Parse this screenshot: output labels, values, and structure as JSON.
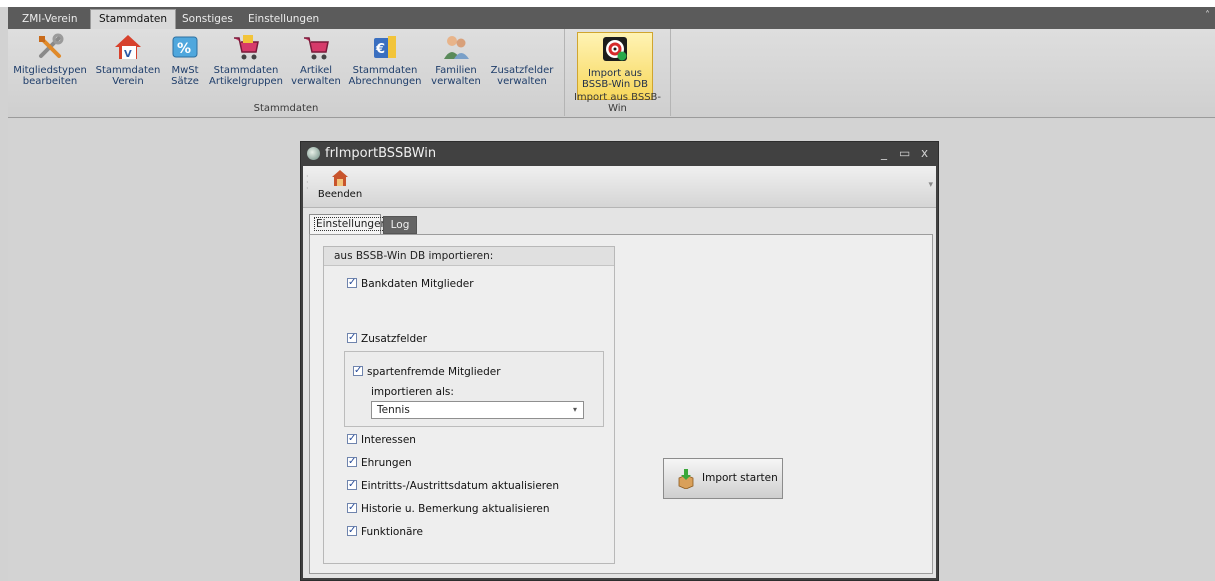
{
  "ribbon": {
    "tabs": [
      "ZMI-Verein",
      "Stammdaten",
      "Sonstiges",
      "Einstellungen"
    ],
    "active_tab": "Stammdaten",
    "groups": {
      "stammdaten": {
        "label": "Stammdaten",
        "buttons": [
          {
            "label1": "Mitgliedstypen",
            "label2": "bearbeiten",
            "icon": "tools-icon"
          },
          {
            "label1": "Stammdaten",
            "label2": "Verein",
            "icon": "house-icon"
          },
          {
            "label1": "MwSt",
            "label2": "Sätze",
            "icon": "percent-icon"
          },
          {
            "label1": "Stammdaten",
            "label2": "Artikelgruppen",
            "icon": "cart-icon"
          },
          {
            "label1": "Artikel",
            "label2": "verwalten",
            "icon": "cart-icon"
          },
          {
            "label1": "Stammdaten",
            "label2": "Abrechnungen",
            "icon": "euro-icon"
          },
          {
            "label1": "Familien",
            "label2": "verwalten",
            "icon": "family-icon"
          },
          {
            "label1": "Zusatzfelder",
            "label2": "verwalten",
            "icon": ""
          }
        ]
      },
      "import": {
        "label": "Import aus BSSB-Win",
        "button": {
          "label1": "Import aus",
          "label2": "BSSB-Win DB",
          "icon": "target-icon"
        }
      }
    }
  },
  "form": {
    "title": "frImportBSSBWin",
    "window_buttons": {
      "minimize": "_",
      "maximize": "▭",
      "close": "x"
    },
    "toolbar": {
      "beenden_label": "Beenden"
    },
    "tabs": {
      "settings": "Einstellungen",
      "log": "Log"
    },
    "group_title": "aus BSSB-Win DB importieren:",
    "checkboxes": {
      "bankdaten": "Bankdaten Mitglieder",
      "zusatzfelder": "Zusatzfelder",
      "spartenfremde": "spartenfremde Mitglieder",
      "interessen": "Interessen",
      "ehrungen": "Ehrungen",
      "eintritt": "Eintritts-/Austrittsdatum aktualisieren",
      "historie": "Historie u. Bemerkung aktualisieren",
      "funktionaere": "Funktionäre"
    },
    "import_as_label": "importieren als:",
    "import_as_value": "Tennis",
    "import_button": "Import starten"
  }
}
